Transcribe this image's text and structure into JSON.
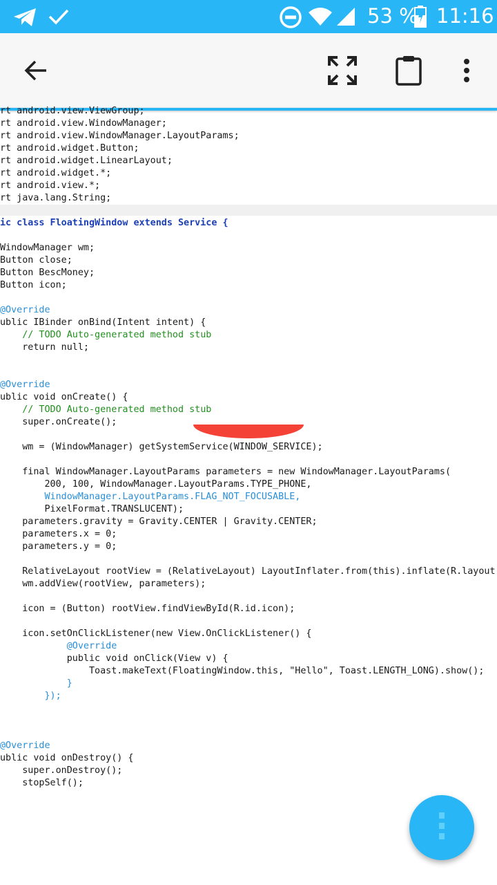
{
  "status_bar": {
    "battery_percent": "53 %",
    "time": "11:16",
    "icons": [
      "telegram-icon",
      "check-icon",
      "do-not-disturb-icon",
      "wifi-icon",
      "signal-icon",
      "battery-icon"
    ]
  },
  "toolbar": {
    "icons": [
      "back-arrow-icon",
      "fullscreen-icon",
      "clipboard-icon",
      "more-vert-icon"
    ]
  },
  "code_lines": [
    "rt android.view.ViewGroup;",
    "rt android.view.WindowManager;",
    "rt android.view.WindowManager.LayoutParams;",
    "rt android.widget.Button;",
    "rt android.widget.LinearLayout;",
    "rt android.widget.*;",
    "rt android.view.*;",
    "rt java.lang.String;",
    "",
    "ic class FloatingWindow extends Service {",
    "",
    "WindowManager wm;",
    "Button close;",
    "Button BescMoney;",
    "Button icon;",
    "",
    "@Override",
    "ublic IBinder onBind(Intent intent) {",
    "    // TODO Auto-generated method stub",
    "    return null;",
    "",
    "",
    "@Override",
    "ublic void onCreate() {",
    "    // TODO Auto-generated method stub",
    "    super.onCreate();",
    "",
    "    wm = (WindowManager) getSystemService(WINDOW_SERVICE);",
    "",
    "    final WindowManager.LayoutParams parameters = new WindowManager.LayoutParams(",
    "        200, 100, WindowManager.LayoutParams.TYPE_PHONE,",
    "        WindowManager.LayoutParams.FLAG_NOT_FOCUSABLE,",
    "        PixelFormat.TRANSLUCENT);",
    "    parameters.gravity = Gravity.CENTER | Gravity.CENTER;",
    "    parameters.x = 0;",
    "    parameters.y = 0;",
    "",
    "    RelativeLayout rootView = (RelativeLayout) LayoutInflater.from(this).inflate(R.layout.F",
    "    wm.addView(rootView, parameters);",
    "",
    "    icon = (Button) rootView.findViewById(R.id.icon);",
    "",
    "    icon.setOnClickListener(new View.OnClickListener() {",
    "            @Override",
    "            public void onClick(View v) {",
    "                Toast.makeText(FloatingWindow.this, \"Hello\", Toast.LENGTH_LONG).show();",
    "            }",
    "        });",
    "",
    "",
    "",
    "@Override",
    "ublic void onDestroy() {",
    "    super.onDestroy();",
    "    stopSelf();",
    ""
  ],
  "fab": {
    "icon": "more-vert-icon"
  },
  "colors": {
    "accent": "#29b6f6",
    "keyword": "#1c3fb5",
    "type": "#2a8fd8",
    "comment": "#22901f",
    "literal": "#c8102e"
  }
}
